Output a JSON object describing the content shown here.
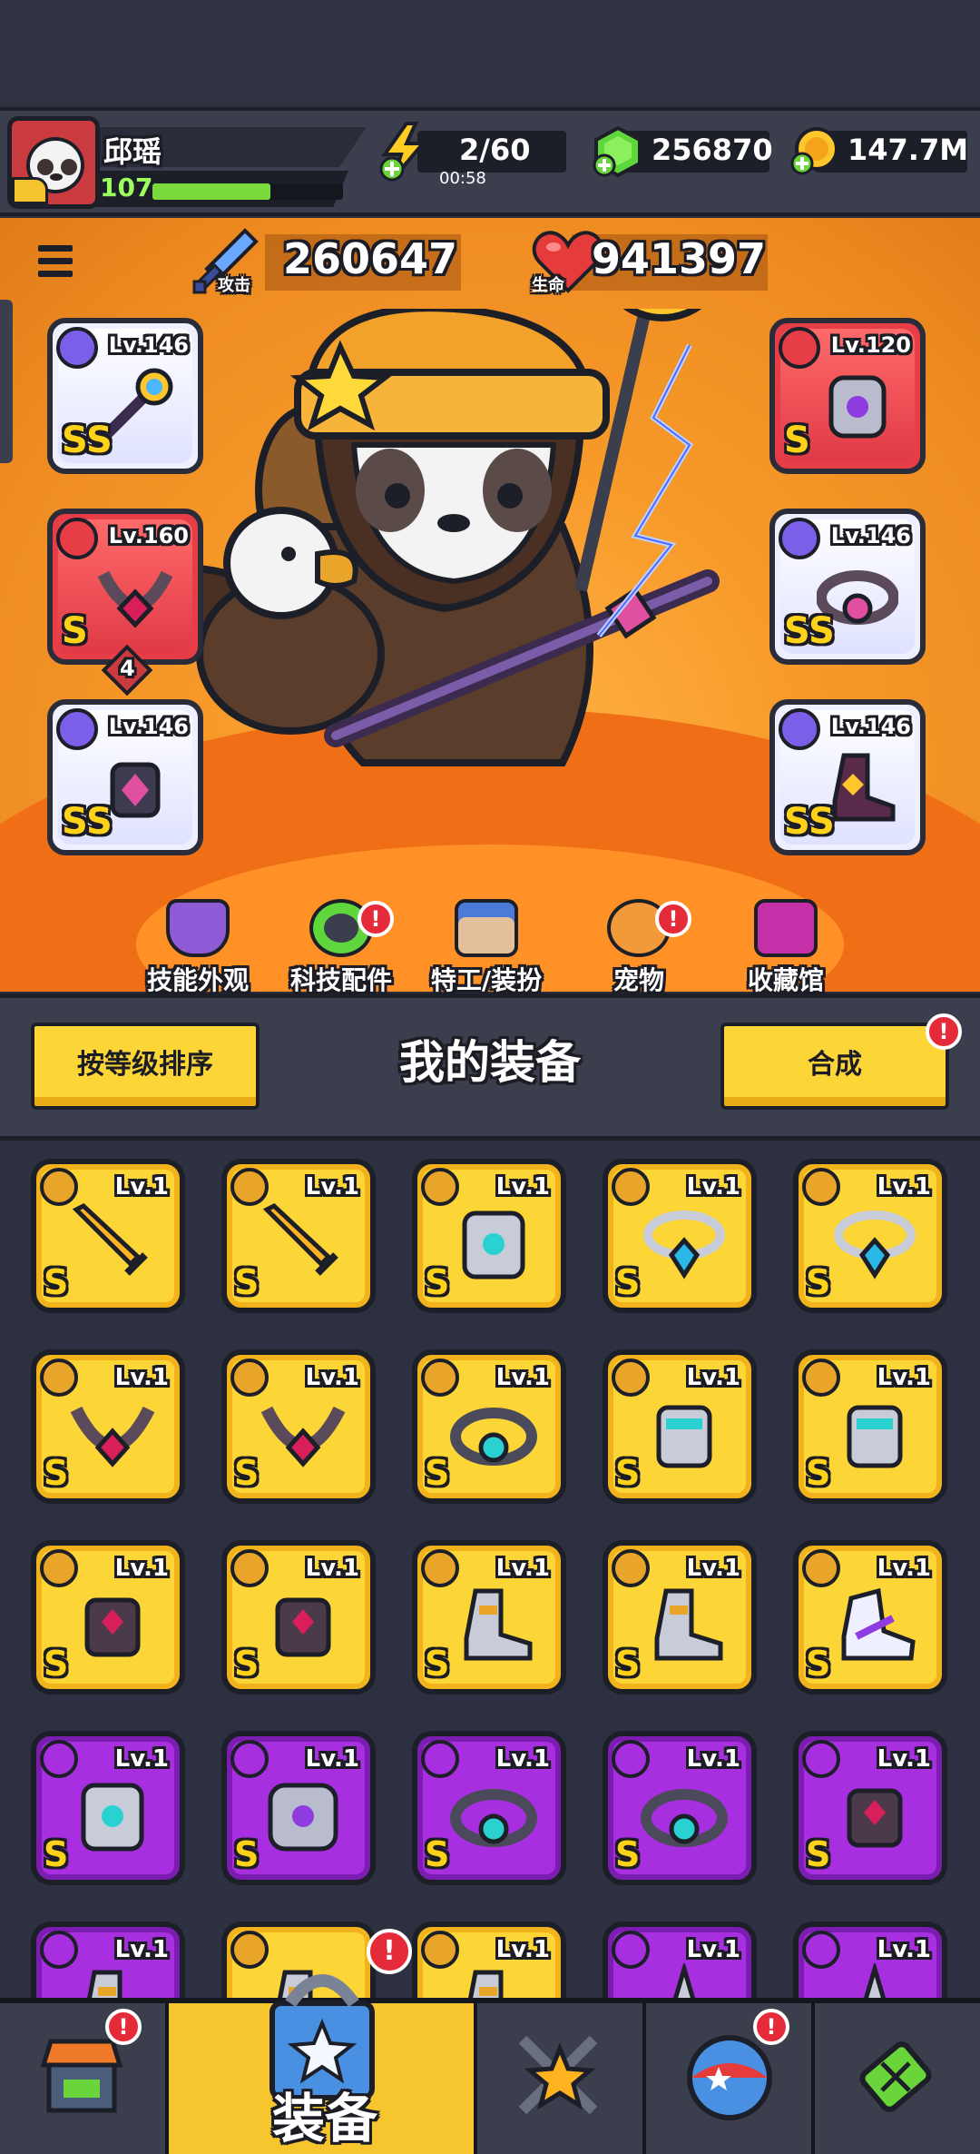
{
  "player": {
    "name": "邱瑶",
    "level": "107",
    "xp_fraction": 0.62
  },
  "resources": {
    "energy": "2/60",
    "energy_timer": "00:58",
    "gems": "256870",
    "coins": "147.7M"
  },
  "stats": {
    "attack_label": "攻击",
    "attack_value": "260647",
    "hp_label": "生命",
    "hp_value": "941397"
  },
  "equipped": {
    "weapon": {
      "level": "Lv.146",
      "tier": "SS"
    },
    "necklace": {
      "level": "Lv.160",
      "tier": "S",
      "stars": "4"
    },
    "gloves": {
      "level": "Lv.146",
      "tier": "SS"
    },
    "armor": {
      "level": "Lv.120",
      "tier": "S"
    },
    "belt": {
      "level": "Lv.146",
      "tier": "SS"
    },
    "boots": {
      "level": "Lv.146",
      "tier": "SS"
    }
  },
  "nav": {
    "skill_skin": "技能外观",
    "tech_parts": "科技配件",
    "agent_outfit": "特工/装扮",
    "pets": "宠物",
    "collection": "收藏馆"
  },
  "section": {
    "sort_button": "按等级排序",
    "title": "我的装备",
    "merge_button": "合成"
  },
  "alert_mark": "!",
  "inventory": [
    {
      "level": "Lv.1",
      "tier": "S",
      "rarity": "gold",
      "type": "weapon",
      "icon": "sword-icon"
    },
    {
      "level": "Lv.1",
      "tier": "S",
      "rarity": "gold",
      "type": "weapon",
      "icon": "sword-icon"
    },
    {
      "level": "Lv.1",
      "tier": "S",
      "rarity": "gold",
      "type": "armor",
      "icon": "armor-icon"
    },
    {
      "level": "Lv.1",
      "tier": "S",
      "rarity": "gold",
      "type": "necklace",
      "icon": "necklace-icon"
    },
    {
      "level": "Lv.1",
      "tier": "S",
      "rarity": "gold",
      "type": "necklace",
      "icon": "necklace-icon"
    },
    {
      "level": "Lv.1",
      "tier": "S",
      "rarity": "gold",
      "type": "necklace",
      "icon": "chain-necklace-icon"
    },
    {
      "level": "Lv.1",
      "tier": "S",
      "rarity": "gold",
      "type": "necklace",
      "icon": "chain-necklace-icon"
    },
    {
      "level": "Lv.1",
      "tier": "S",
      "rarity": "gold",
      "type": "belt",
      "icon": "belt-icon"
    },
    {
      "level": "Lv.1",
      "tier": "S",
      "rarity": "gold",
      "type": "gloves",
      "icon": "gauntlet-icon"
    },
    {
      "level": "Lv.1",
      "tier": "S",
      "rarity": "gold",
      "type": "gloves",
      "icon": "gauntlet-icon"
    },
    {
      "level": "Lv.1",
      "tier": "S",
      "rarity": "gold",
      "type": "gloves",
      "icon": "claw-glove-icon"
    },
    {
      "level": "Lv.1",
      "tier": "S",
      "rarity": "gold",
      "type": "gloves",
      "icon": "claw-glove-icon"
    },
    {
      "level": "Lv.1",
      "tier": "S",
      "rarity": "gold",
      "type": "boots",
      "icon": "boot-icon"
    },
    {
      "level": "Lv.1",
      "tier": "S",
      "rarity": "gold",
      "type": "boots",
      "icon": "boot-icon"
    },
    {
      "level": "Lv.1",
      "tier": "S",
      "rarity": "gold",
      "type": "boots",
      "icon": "sneaker-icon"
    },
    {
      "level": "Lv.1",
      "tier": "S",
      "rarity": "purple",
      "type": "armor",
      "icon": "armor-icon"
    },
    {
      "level": "Lv.1",
      "tier": "S",
      "rarity": "purple",
      "type": "armor",
      "icon": "shoulder-armor-icon"
    },
    {
      "level": "Lv.1",
      "tier": "S",
      "rarity": "purple",
      "type": "belt",
      "icon": "belt-icon"
    },
    {
      "level": "Lv.1",
      "tier": "S",
      "rarity": "purple",
      "type": "belt",
      "icon": "belt-icon"
    },
    {
      "level": "Lv.1",
      "tier": "S",
      "rarity": "purple",
      "type": "gloves",
      "icon": "claw-glove-icon"
    },
    {
      "level": "Lv.1",
      "tier": "",
      "rarity": "purple",
      "type": "boots",
      "icon": "boot-icon"
    },
    {
      "level": "",
      "tier": "",
      "rarity": "gold",
      "type": "boots",
      "icon": "boot-icon"
    },
    {
      "level": "Lv.1",
      "tier": "",
      "rarity": "gold",
      "type": "boots",
      "icon": "boot-icon"
    },
    {
      "level": "Lv.1",
      "tier": "",
      "rarity": "purple",
      "type": "weapon",
      "icon": "shuriken-icon"
    },
    {
      "level": "Lv.1",
      "tier": "",
      "rarity": "purple",
      "type": "weapon",
      "icon": "shuriken-icon"
    }
  ],
  "bottom_tabs": {
    "equip_label": "装备"
  },
  "colors": {
    "gold_rarity": "#fcd537",
    "purple_rarity": "#a72fe0",
    "red_rarity": "#e63d47",
    "white_rarity": "#eef0ff",
    "accent_orange": "#f79a2a"
  }
}
